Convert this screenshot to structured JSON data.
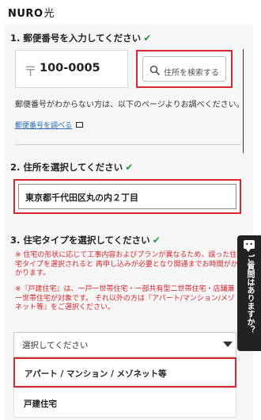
{
  "header": {
    "logo_text": "NURO",
    "logo_kanji": "光"
  },
  "step1": {
    "title": "1. 郵便番号を入力してください",
    "zip_mark": "〒",
    "zip_value": "100-0005",
    "search_label": "住所を検索する",
    "help_text": "郵便番号がわからない方は、以下のページよりお調べください。",
    "help_link": "郵便番号を調べる"
  },
  "step2": {
    "title": "2. 住所を選択してください",
    "selected_address": "東京都千代田区丸の内２丁目"
  },
  "step3": {
    "title": "3. 住宅タイプを選択してください",
    "note1": "※ 住宅の形状に応じて工事内容およびプランが異なるため、誤った住宅タイプを選択されると 再申し込みが必要となり開通までお時間がかかります。",
    "note2": "※『戸建住宅』は、一戸一世帯住宅・一部共有型二世帯住宅・店舗兼一世帯住宅が対象です。 それ以外の方は『アパート/マンション/メゾネット等』をご選択ください。",
    "select_placeholder": "選択してください",
    "options": [
      "アパート / マンション / メゾネット等",
      "戸建住宅"
    ]
  },
  "chat": {
    "label": "ご質問はありますか？"
  },
  "colors": {
    "accent_red": "#d9262f",
    "check_green": "#1f9a3c",
    "link_blue": "#2a6db5"
  }
}
